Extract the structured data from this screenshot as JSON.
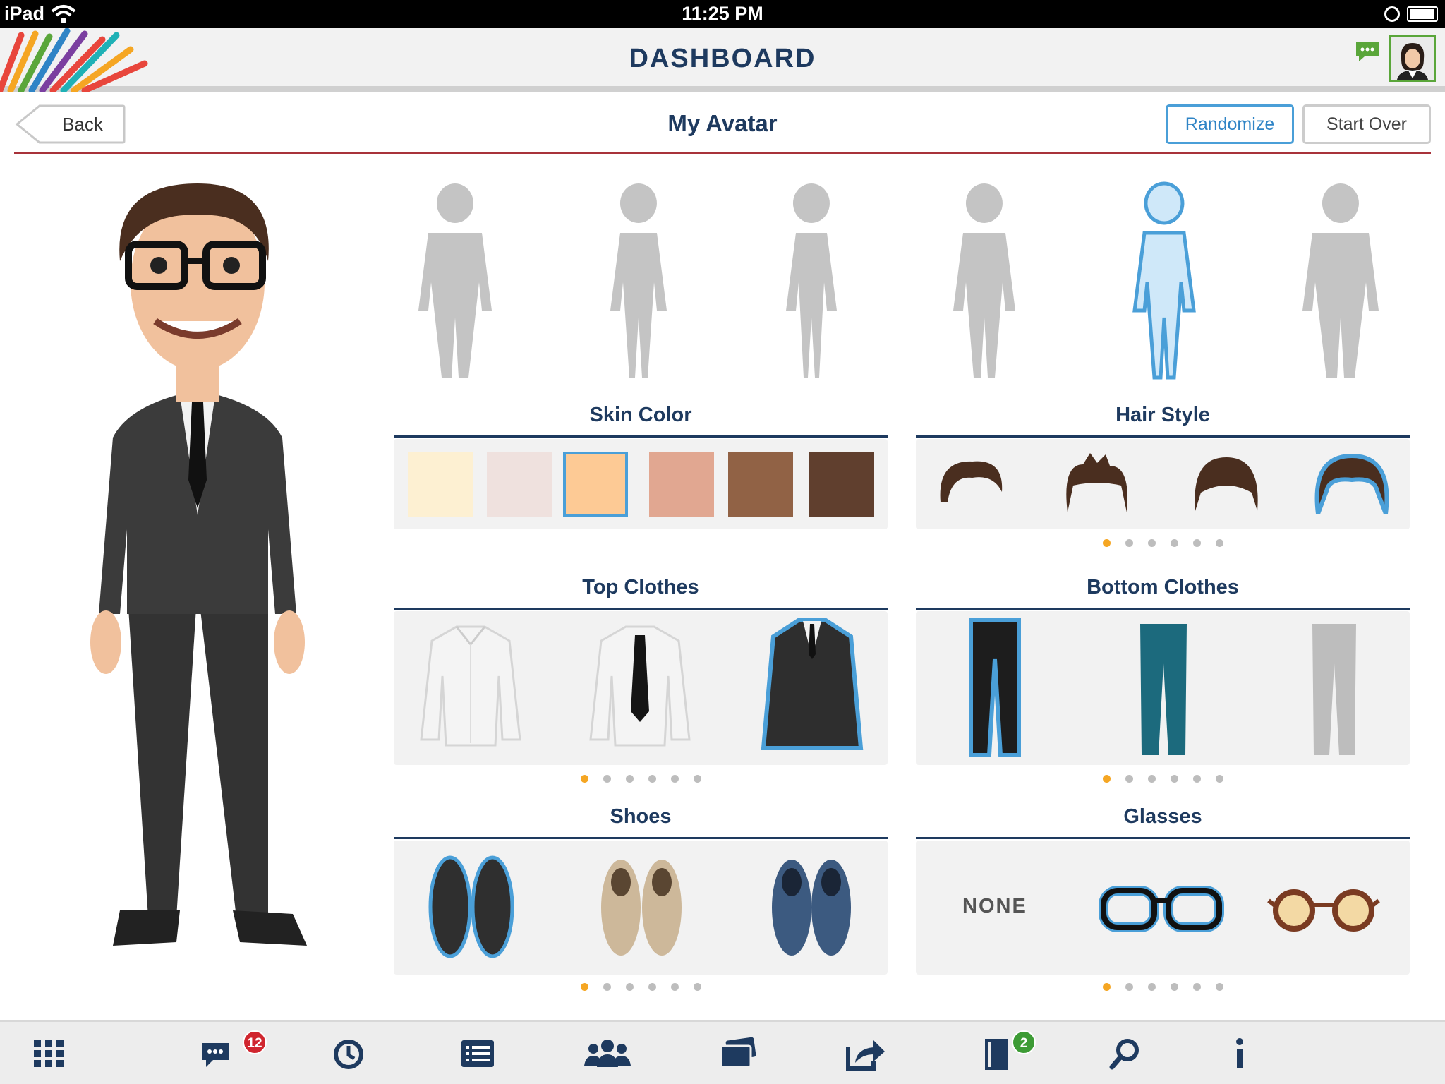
{
  "status_bar": {
    "device": "iPad",
    "time": "11:25 PM"
  },
  "header": {
    "title": "DASHBOARD"
  },
  "toolbar": {
    "back_label": "Back",
    "title": "My Avatar",
    "randomize_label": "Randomize",
    "start_over_label": "Start Over"
  },
  "body_types": {
    "count": 6,
    "selected_index": 4
  },
  "sections": {
    "skin_color": {
      "title": "Skin Color",
      "swatches": [
        "#fdf0d2",
        "#efe1de",
        "#fdca95",
        "#e1a791",
        "#916245",
        "#603f2e"
      ],
      "selected_index": 2
    },
    "hair_style": {
      "title": "Hair Style",
      "selected_index": 3,
      "page": 1,
      "pages": 6
    },
    "top_clothes": {
      "title": "Top Clothes",
      "items": [
        "white shirt",
        "white shirt with tie",
        "black suit"
      ],
      "selected_index": 2,
      "page": 1,
      "pages": 6
    },
    "bottom_clothes": {
      "title": "Bottom Clothes",
      "items": [
        "black pants",
        "teal pants",
        "grey pants"
      ],
      "selected_index": 0,
      "page": 1,
      "pages": 6
    },
    "shoes": {
      "title": "Shoes",
      "items": [
        "black shoes",
        "tan shoes",
        "blue shoes"
      ],
      "selected_index": 0,
      "page": 1,
      "pages": 6
    },
    "glasses": {
      "title": "Glasses",
      "none_label": "NONE",
      "selected_index": 1,
      "page": 1,
      "pages": 6
    }
  },
  "tab_bar": {
    "messages_badge": "12",
    "notebook_badge": "2"
  },
  "colors": {
    "accent": "#4a9fd8",
    "navy": "#1e3a5f",
    "divider": "#a8323a",
    "dot_active": "#f5a623"
  }
}
